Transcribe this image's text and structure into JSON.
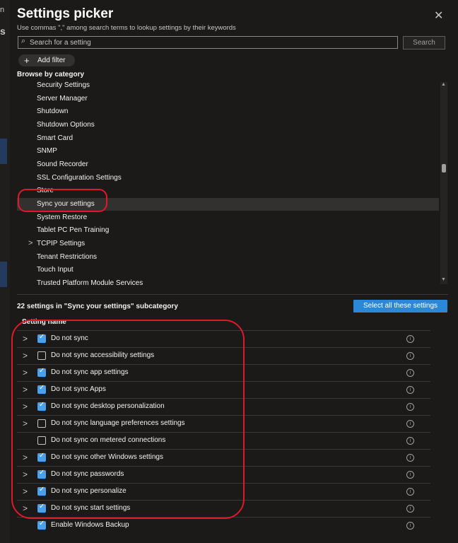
{
  "left_fragments": [
    "n",
    "s"
  ],
  "panel": {
    "title": "Settings picker",
    "subtitle": "Use commas \",\" among search terms to lookup settings by their keywords",
    "close_glyph": "✕"
  },
  "search": {
    "placeholder": "Search for a setting",
    "button_label": "Search",
    "icon": "search-icon"
  },
  "add_filter": {
    "label": "Add filter",
    "icon": "plus-icon"
  },
  "browse_label": "Browse by category",
  "categories": [
    {
      "label": "Security Settings",
      "expandable": false
    },
    {
      "label": "Server Manager",
      "expandable": false
    },
    {
      "label": "Shutdown",
      "expandable": false
    },
    {
      "label": "Shutdown Options",
      "expandable": false
    },
    {
      "label": "Smart Card",
      "expandable": false
    },
    {
      "label": "SNMP",
      "expandable": false
    },
    {
      "label": "Sound Recorder",
      "expandable": false
    },
    {
      "label": "SSL Configuration Settings",
      "expandable": false
    },
    {
      "label": "Store",
      "expandable": false
    },
    {
      "label": "Sync your settings",
      "expandable": false,
      "selected": true
    },
    {
      "label": "System Restore",
      "expandable": false
    },
    {
      "label": "Tablet PC Pen Training",
      "expandable": false
    },
    {
      "label": "TCPIP Settings",
      "expandable": true
    },
    {
      "label": "Tenant Restrictions",
      "expandable": false
    },
    {
      "label": "Touch Input",
      "expandable": false
    },
    {
      "label": "Trusted Platform Module Services",
      "expandable": false
    }
  ],
  "results": {
    "count_text": "22 settings in \"Sync your settings\" subcategory",
    "select_all_label": "Select all these settings",
    "column_header": "Setting name"
  },
  "settings": [
    {
      "name": "Do not sync",
      "checked": true,
      "expandable": true
    },
    {
      "name": "Do not sync accessibility settings",
      "checked": false,
      "expandable": true
    },
    {
      "name": "Do not sync app settings",
      "checked": true,
      "expandable": true
    },
    {
      "name": "Do not sync Apps",
      "checked": true,
      "expandable": true
    },
    {
      "name": "Do not sync desktop personalization",
      "checked": true,
      "expandable": true
    },
    {
      "name": "Do not sync language preferences settings",
      "checked": false,
      "expandable": true
    },
    {
      "name": "Do not sync on metered connections",
      "checked": false,
      "expandable": false
    },
    {
      "name": "Do not sync other Windows settings",
      "checked": true,
      "expandable": true
    },
    {
      "name": "Do not sync passwords",
      "checked": true,
      "expandable": true
    },
    {
      "name": "Do not sync personalize",
      "checked": true,
      "expandable": true
    },
    {
      "name": "Do not sync start settings",
      "checked": true,
      "expandable": true
    },
    {
      "name": "Enable Windows Backup",
      "checked": true,
      "expandable": false
    }
  ],
  "colors": {
    "accent": "#2b88d8",
    "checkbox": "#4f9fe6",
    "annotation": "#e0192a",
    "background": "#1b1a19"
  }
}
